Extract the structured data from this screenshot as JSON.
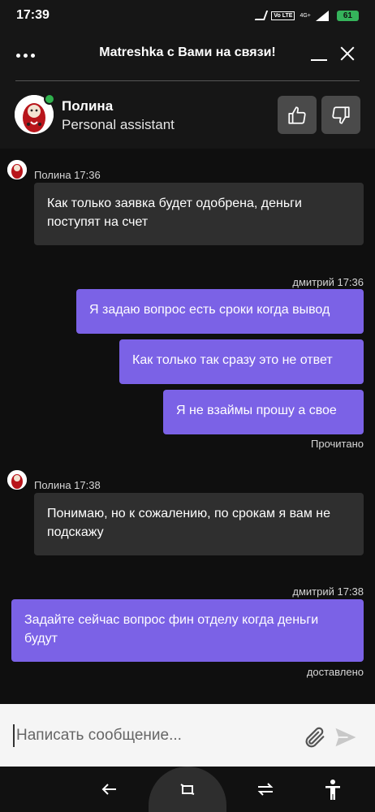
{
  "status_bar": {
    "time": "17:39",
    "network": "4G+",
    "battery": "61"
  },
  "header": {
    "title": "Matreshka с Вами на связи!"
  },
  "agent": {
    "name": "Полина",
    "role": "Personal assistant"
  },
  "messages": [
    {
      "meta": "Полина 17:36",
      "text": "Как только заявка будет одобрена, деньги поступят на счет"
    },
    {
      "meta": "дмитрий 17:36",
      "texts": [
        "Я задаю вопрос есть сроки когда вывод",
        "Как только так сразу это не ответ",
        "Я не взаймы прошу а свое"
      ],
      "status": "Прочитано"
    },
    {
      "meta": "Полина 17:38",
      "text": "Понимаю, но к сожалению, по срокам я вам не подскажу"
    },
    {
      "meta": "дмитрий 17:38",
      "text": "Задайте сейчас вопрос фин отделу когда деньги будут",
      "status": "доставлено"
    }
  ],
  "composer": {
    "placeholder": "Написать сообщение..."
  },
  "colors": {
    "accent": "#7b62e6",
    "incoming": "#2f2f2f",
    "online": "#2fb14d",
    "background": "#0f0f0f"
  }
}
